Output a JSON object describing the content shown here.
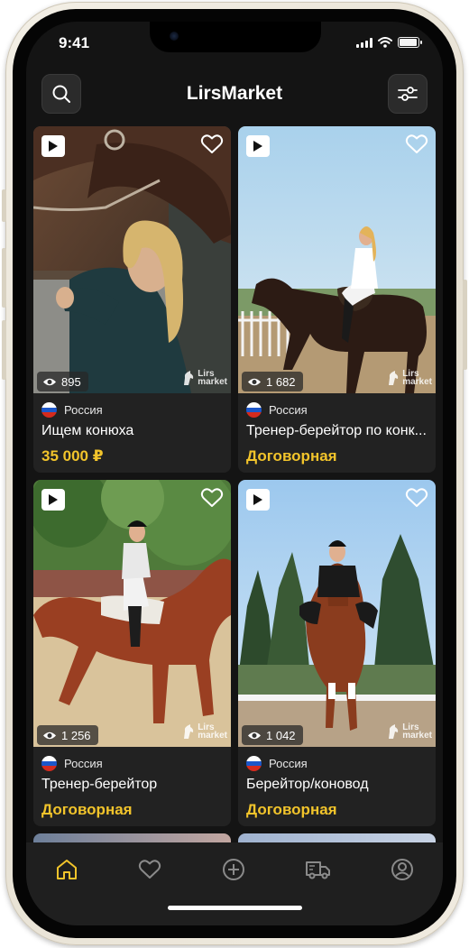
{
  "status_bar": {
    "time": "9:41"
  },
  "header": {
    "title": "LirsMarket",
    "search_icon": "search-icon",
    "filter_icon": "filter-sliders-icon"
  },
  "watermark": [
    "Lirs",
    "market"
  ],
  "listings": [
    {
      "country": "Россия",
      "title": "Ищем конюха",
      "price": "35 000 ₽",
      "views": "895"
    },
    {
      "country": "Россия",
      "title": "Тренер-берейтор по конк...",
      "price": "Договорная",
      "views": "1 682"
    },
    {
      "country": "Россия",
      "title": "Тренер-берейтор",
      "price": "Договорная",
      "views": "1 256"
    },
    {
      "country": "Россия",
      "title": "Берейтор/коновод",
      "price": "Договорная",
      "views": "1 042"
    }
  ],
  "tabbar": {
    "items": [
      "home-icon",
      "favorites-heart-icon",
      "add-plus-icon",
      "delivery-truck-icon",
      "profile-user-icon"
    ],
    "active_color": "#f2c42b",
    "inactive_color": "#8a8a8a"
  },
  "colors": {
    "accent": "#f2c42b",
    "card_bg": "#222222",
    "screen_bg": "#141414"
  }
}
